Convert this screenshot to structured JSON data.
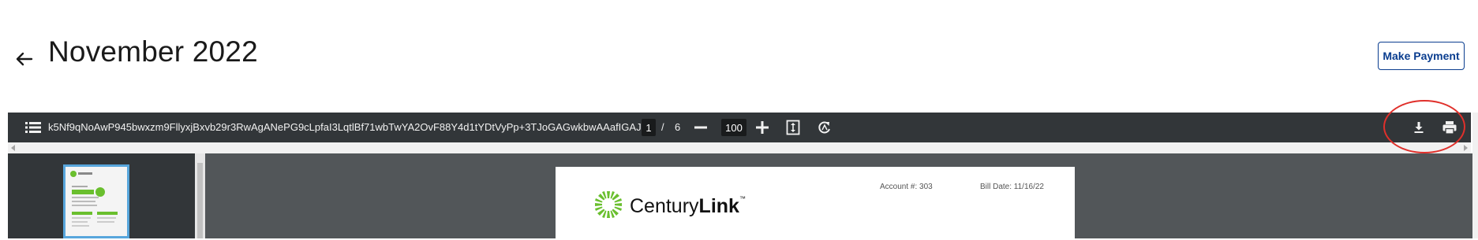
{
  "header": {
    "title": "November 2022",
    "make_payment_label": "Make Payment"
  },
  "pdf_viewer": {
    "document_name": "k5Nf9qNoAwP945bwxzm9FllyxjBxvb29r3RwAgANePG9cLpfaI3LqtlBf71wbTwYA2OvF88Y4d1tYDtVyPp+3TJoGAGwkbwAAafIGAJ...",
    "current_page": "1",
    "page_separator": "/",
    "total_pages": "6",
    "zoom": "100"
  },
  "bill": {
    "account_label": "Account #:  303",
    "bill_date_label": "Bill Date:  11/16/22",
    "brand_regular": "Century",
    "brand_bold": "Link",
    "brand_tm": "™"
  },
  "colors": {
    "toolbar_bg": "#323639",
    "viewer_bg": "#525659",
    "button_accent": "#0a3d8f",
    "highlight": "#e0302b",
    "thumbnail_border": "#58a6dc",
    "logo_green": "#6abf2e"
  }
}
